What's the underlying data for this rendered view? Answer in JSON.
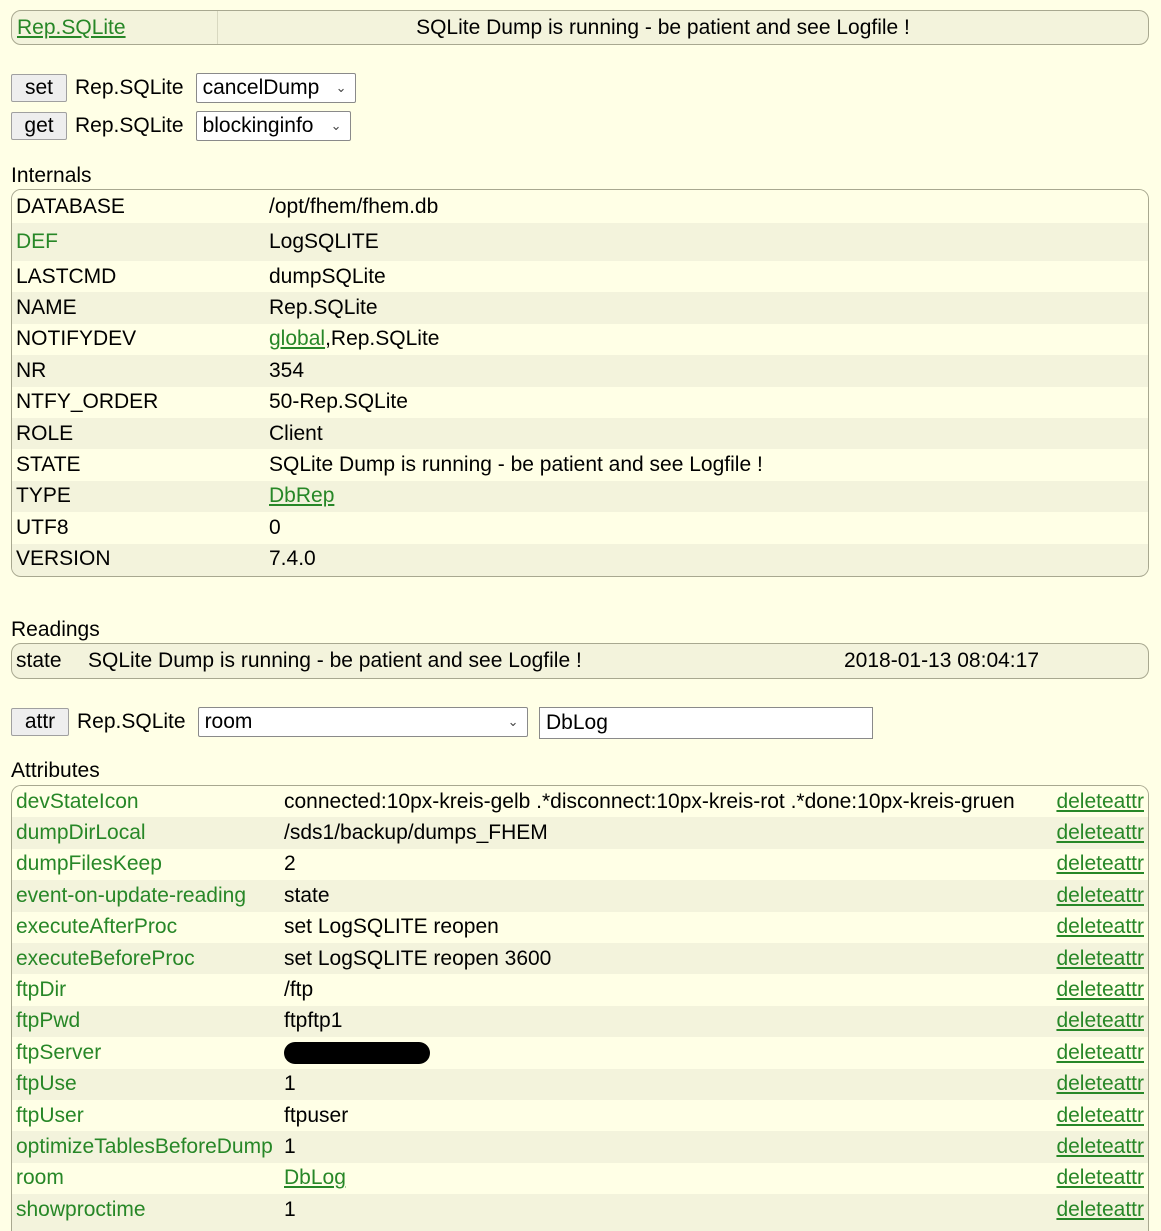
{
  "top": {
    "device_link": "Rep.SQLite",
    "state_text": "SQLite Dump is running - be patient and see Logfile !"
  },
  "commands": [
    {
      "button": "set",
      "device": "Rep.SQLite",
      "selected": "cancelDump"
    },
    {
      "button": "get",
      "device": "Rep.SQLite",
      "selected": "blockinginfo"
    }
  ],
  "internals": {
    "title": "Internals",
    "rows": [
      {
        "key": "DATABASE",
        "value": "/opt/fhem/fhem.db"
      },
      {
        "key": "DEF",
        "value": "LogSQLITE"
      },
      {
        "key": "LASTCMD",
        "value": "dumpSQLite"
      },
      {
        "key": "NAME",
        "value": "Rep.SQLite"
      },
      {
        "key": "NOTIFYDEV",
        "value_link": "global",
        "value": ",Rep.SQLite"
      },
      {
        "key": "NR",
        "value": "354"
      },
      {
        "key": "NTFY_ORDER",
        "value": "50-Rep.SQLite"
      },
      {
        "key": "ROLE",
        "value": "Client"
      },
      {
        "key": "STATE",
        "value": "SQLite Dump is running - be patient and see Logfile !"
      },
      {
        "key": "TYPE",
        "value_link": "DbRep"
      },
      {
        "key": "UTF8",
        "value": "0"
      },
      {
        "key": "VERSION",
        "value": "7.4.0"
      }
    ]
  },
  "readings": {
    "title": "Readings",
    "row": {
      "key": "state",
      "value": "SQLite Dump is running - be patient and see Logfile !",
      "timestamp": "2018-01-13 08:04:17"
    }
  },
  "attr": {
    "button": "attr",
    "device": "Rep.SQLite",
    "selected": "room",
    "input_value": "DbLog"
  },
  "attributes": {
    "title": "Attributes",
    "delete_label": "deleteattr",
    "rows": [
      {
        "key": "devStateIcon",
        "value": "connected:10px-kreis-gelb .*disconnect:10px-kreis-rot .*done:10px-kreis-gruen"
      },
      {
        "key": "dumpDirLocal",
        "value": "/sds1/backup/dumps_FHEM"
      },
      {
        "key": "dumpFilesKeep",
        "value": "2"
      },
      {
        "key": "event-on-update-reading",
        "value": "state"
      },
      {
        "key": "executeAfterProc",
        "value": "set LogSQLITE reopen"
      },
      {
        "key": "executeBeforeProc",
        "value": "set LogSQLITE reopen 3600"
      },
      {
        "key": "ftpDir",
        "value": "/ftp"
      },
      {
        "key": "ftpPwd",
        "value": "ftpftp1"
      },
      {
        "key": "ftpServer",
        "value": ""
      },
      {
        "key": "ftpUse",
        "value": "1"
      },
      {
        "key": "ftpUser",
        "value": "ftpuser"
      },
      {
        "key": "optimizeTablesBeforeDump",
        "value": "1"
      },
      {
        "key": "room",
        "value_link": "DbLog"
      },
      {
        "key": "showproctime",
        "value": "1"
      }
    ]
  }
}
